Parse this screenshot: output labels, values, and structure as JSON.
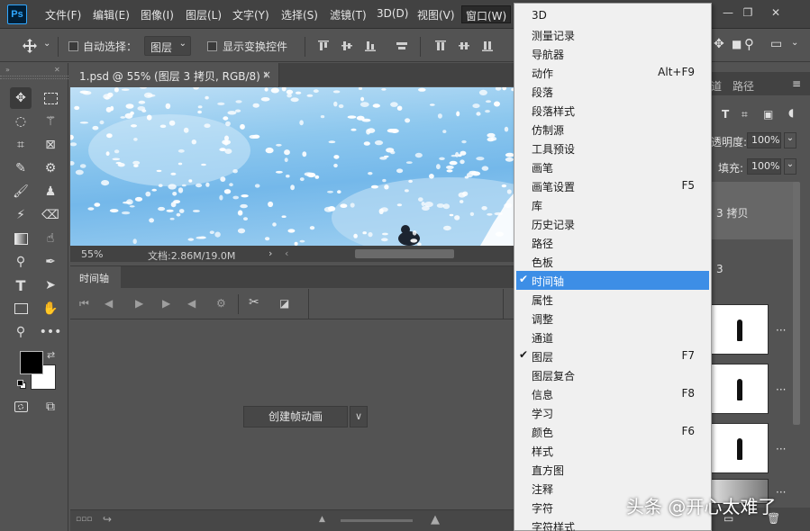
{
  "app": {
    "logo": "Ps",
    "menus": [
      {
        "label": "文件(F)"
      },
      {
        "label": "编辑(E)"
      },
      {
        "label": "图像(I)"
      },
      {
        "label": "图层(L)"
      },
      {
        "label": "文字(Y)"
      },
      {
        "label": "选择(S)"
      },
      {
        "label": "滤镜(T)"
      },
      {
        "label": "3D(D)"
      },
      {
        "label": "视图(V)"
      },
      {
        "label": "窗口(W)"
      }
    ]
  },
  "options_bar": {
    "auto_select_label": "自动选择：",
    "auto_select_value": "图层",
    "show_transform_label": "显示变换控件"
  },
  "document": {
    "tab_title": "1.psd @ 55% (图层 3 拷贝, RGB/8) *",
    "zoom": "55%",
    "doc_size": "文档:2.86M/19.0M"
  },
  "timeline": {
    "tab_label": "时间轴",
    "create_button": "创建帧动画"
  },
  "right_panel": {
    "tab_channels_partial": "道",
    "tab_paths": "路径",
    "opacity_label": "透明度:",
    "opacity_value": "100%",
    "fill_label": "填充:",
    "fill_value": "100%",
    "layers": [
      {
        "name": "3 拷贝"
      },
      {
        "name": "3"
      }
    ]
  },
  "window_menu": {
    "items": [
      {
        "label": "3D",
        "shortcut": "",
        "checked": false
      },
      {
        "label": "测量记录",
        "shortcut": "",
        "checked": false
      },
      {
        "label": "导航器",
        "shortcut": "",
        "checked": false
      },
      {
        "label": "动作",
        "shortcut": "Alt+F9",
        "checked": false
      },
      {
        "label": "段落",
        "shortcut": "",
        "checked": false
      },
      {
        "label": "段落样式",
        "shortcut": "",
        "checked": false
      },
      {
        "label": "仿制源",
        "shortcut": "",
        "checked": false
      },
      {
        "label": "工具预设",
        "shortcut": "",
        "checked": false
      },
      {
        "label": "画笔",
        "shortcut": "",
        "checked": false
      },
      {
        "label": "画笔设置",
        "shortcut": "F5",
        "checked": false
      },
      {
        "label": "库",
        "shortcut": "",
        "checked": false
      },
      {
        "label": "历史记录",
        "shortcut": "",
        "checked": false
      },
      {
        "label": "路径",
        "shortcut": "",
        "checked": false
      },
      {
        "label": "色板",
        "shortcut": "",
        "checked": false
      },
      {
        "label": "时间轴",
        "shortcut": "",
        "checked": true,
        "highlighted": true
      },
      {
        "label": "属性",
        "shortcut": "",
        "checked": false
      },
      {
        "label": "调整",
        "shortcut": "",
        "checked": false
      },
      {
        "label": "通道",
        "shortcut": "",
        "checked": false
      },
      {
        "label": "图层",
        "shortcut": "F7",
        "checked": true
      },
      {
        "label": "图层复合",
        "shortcut": "",
        "checked": false
      },
      {
        "label": "信息",
        "shortcut": "F8",
        "checked": false
      },
      {
        "label": "学习",
        "shortcut": "",
        "checked": false
      },
      {
        "label": "颜色",
        "shortcut": "F6",
        "checked": false
      },
      {
        "label": "样式",
        "shortcut": "",
        "checked": false
      },
      {
        "label": "直方图",
        "shortcut": "",
        "checked": false
      },
      {
        "label": "注释",
        "shortcut": "",
        "checked": false
      },
      {
        "label": "字符",
        "shortcut": "",
        "checked": false
      },
      {
        "label": "字符样式",
        "shortcut": "",
        "checked": false
      }
    ],
    "highlight_color": "#3d8ee6"
  },
  "watermark": "头条 @开心太难了",
  "colors": {
    "foreground": "#000000",
    "background": "#ffffff"
  }
}
